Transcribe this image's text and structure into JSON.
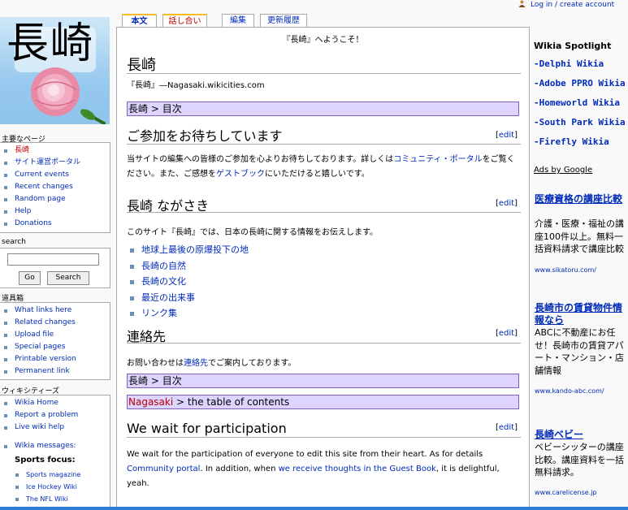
{
  "user": {
    "login_label": "Log in / create account"
  },
  "logo": {
    "text": "長崎"
  },
  "tabs": {
    "article": "本文",
    "discussion": "話し合い",
    "edit": "編集",
    "history": "更新履歴"
  },
  "nav": {
    "title": "主要なページ",
    "items": [
      "長崎",
      "サイト運営ポータル",
      "Current events",
      "Recent changes",
      "Random page",
      "Help",
      "Donations"
    ]
  },
  "search": {
    "title": "search",
    "go": "Go",
    "search": "Search"
  },
  "toolbox": {
    "title": "道具箱",
    "items": [
      "What links here",
      "Related changes",
      "Upload file",
      "Special pages",
      "Printable version",
      "Permanent link"
    ]
  },
  "wikicities": {
    "title": "ウィキシティーズ",
    "items": [
      "Wikia Home",
      "Report a problem",
      "Live wiki help",
      "Wikia messages:"
    ],
    "sports_focus": "Sports focus:",
    "sub_items": [
      "Sports magazine",
      "Ice Hockey Wiki",
      "The NFL Wiki"
    ]
  },
  "content": {
    "site_notice": "『長崎』へようこそ！",
    "title": "長崎",
    "subtitle": "『長崎』―Nagasaki.wikicities.com",
    "toc1": {
      "link": "長崎",
      "rest": " > 目次"
    },
    "section1": {
      "heading": "ご参加をお待ちしています",
      "edit": "edit",
      "text_1": "当サイトの編集への皆様のご参加を心よりお待ちしております。詳しくは",
      "link_1": "コミュニティ・ポータル",
      "text_2": "をご覧ください。また、ご感想を",
      "link_2": "ゲストブック",
      "text_3": "にいただけると嬉しいです。"
    },
    "section2": {
      "heading": "長崎 ながさき",
      "edit": "edit",
      "intro": "このサイト『長崎』では、日本の長崎に関する情報をお伝えします。",
      "items": [
        "地球上最後の原爆投下の地",
        "長崎の自然",
        "長崎の文化",
        "最近の出来事",
        "リンク集"
      ]
    },
    "section3": {
      "heading": "連絡先",
      "edit": "edit",
      "text_1": "お問い合わせは",
      "link_1": "連絡先",
      "text_2": "でご案内しております。"
    },
    "toc2": {
      "link": "長崎",
      "rest": " > 目次"
    },
    "toc3": {
      "link": "Nagasaki",
      "rest": " > the table of contents"
    },
    "section4": {
      "heading": "We wait for participation",
      "edit": "edit",
      "text_1": "We wait for the participation of everyone to edit this site from their heart. As for details ",
      "link_1": "Community portal",
      "text_2": ". In addition, when ",
      "link_2": "we receive thoughts in the Guest Book",
      "text_3": ", it is delightful, yeah."
    }
  },
  "spotlight": {
    "title": "Wikia Spotlight",
    "items": [
      "-Delphi Wikia",
      "-Adobe PPRO Wikia",
      "-Homeworld Wikia",
      "-South Park Wikia",
      "-Firefly Wikia"
    ]
  },
  "ads": {
    "label": "Ads by Google",
    "list": [
      {
        "title": "医療資格の講座比較",
        "body": "介護・医療・福祉の講座100件以上。無料一括資料請求で講座比較",
        "url": "www.sikatoru.com/"
      },
      {
        "title": "長崎市の賃貸物件情報なら",
        "body": "ABCに不動産にお任せ！長崎市の賃貸アパート・マンション・店舗情報",
        "url": "www.kando-abc.com/"
      },
      {
        "title": "長崎ベビー",
        "body": "ベビーシッターの講座比較。講座資料を一括無料請求。",
        "url": "www.carelicense.jp"
      }
    ]
  },
  "colors": {
    "link": "#002bb8",
    "redlink": "#ba0000",
    "toc_bg": "#ddd4ff",
    "accent": "#fabd23",
    "bottom_bar": "#2d7fd6"
  }
}
